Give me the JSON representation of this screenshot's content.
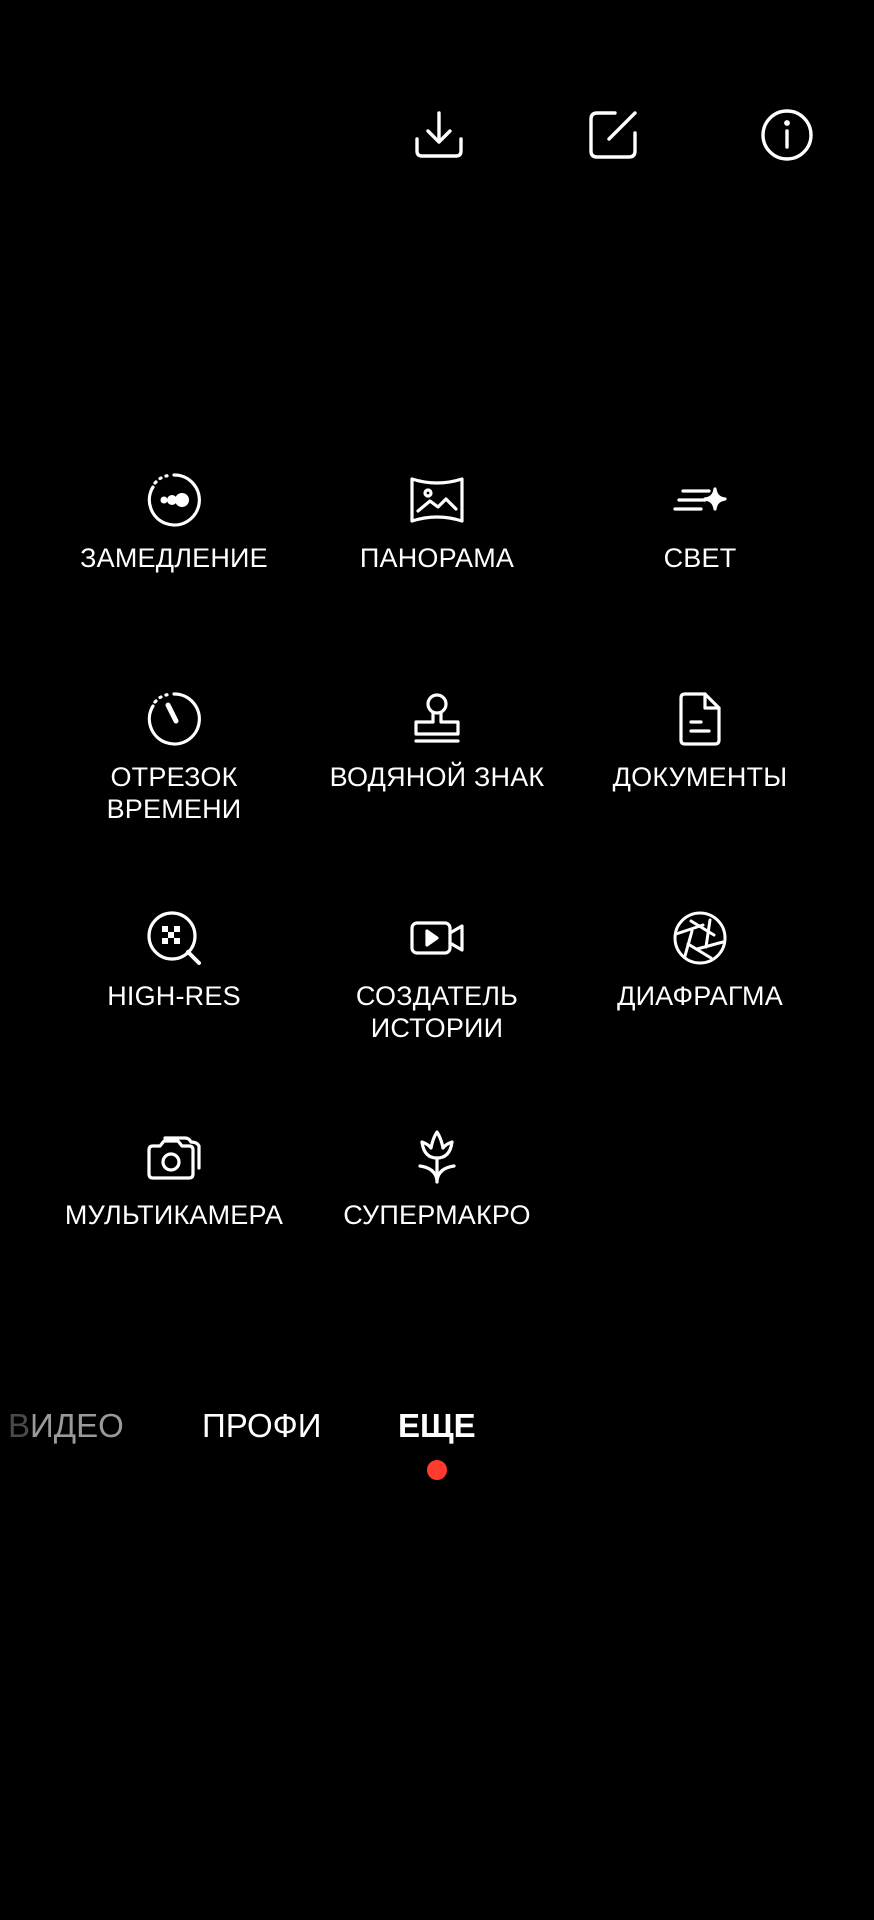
{
  "top_bar": {
    "download_icon": "download-icon",
    "edit_icon": "edit-icon",
    "info_icon": "info-icon"
  },
  "modes": [
    {
      "label": "ЗАМЕДЛЕНИЕ",
      "icon": "slow-motion-icon"
    },
    {
      "label": "ПАНОРАМА",
      "icon": "panorama-icon"
    },
    {
      "label": "СВЕТ",
      "icon": "light-sparkle-icon"
    },
    {
      "label": "ОТРЕЗОК\nВРЕМЕНИ",
      "icon": "timelapse-icon"
    },
    {
      "label": "ВОДЯНОЙ ЗНАК",
      "icon": "stamp-icon"
    },
    {
      "label": "ДОКУМЕНТЫ",
      "icon": "document-icon"
    },
    {
      "label": "HIGH-RES",
      "icon": "high-res-icon"
    },
    {
      "label": "СОЗДАТЕЛЬ\nИСТОРИИ",
      "icon": "story-video-icon"
    },
    {
      "label": "ДИАФРАГМА",
      "icon": "aperture-icon"
    },
    {
      "label": "МУЛЬТИКАМЕРА",
      "icon": "multi-camera-icon"
    },
    {
      "label": "СУПЕРМАКРО",
      "icon": "flower-macro-icon"
    }
  ],
  "mode_tabs": {
    "video_prefix": "В",
    "video_rest": "ИДЕО",
    "pro": "ПРОФИ",
    "more": "ЕЩЕ"
  },
  "colors": {
    "background": "#000000",
    "foreground": "#ffffff",
    "accent_dot": "#ff3b30"
  }
}
